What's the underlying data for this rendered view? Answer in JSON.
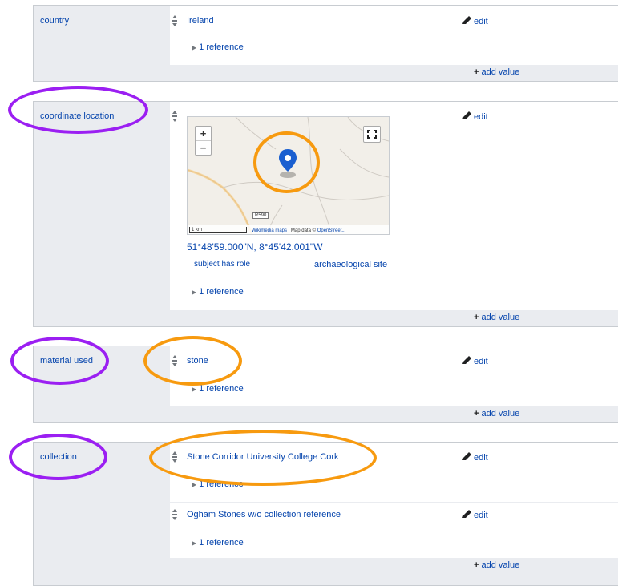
{
  "statements": {
    "country": {
      "property": "country",
      "value": "Ireland",
      "reference": "1 reference",
      "edit": "edit",
      "add_value": "add value"
    },
    "coordinate_location": {
      "property": "coordinate location",
      "coordinates": "51°48'59.000\"N, 8°45'42.001\"W",
      "qualifier_property": "subject has role",
      "qualifier_value": "archaeological site",
      "reference": "1 reference",
      "edit": "edit",
      "add_value": "add value",
      "map": {
        "zoom_in": "+",
        "zoom_out": "−",
        "scale": "1 km",
        "attribution_link": "Wikimedia maps",
        "attribution_text": " | Map data © ",
        "attribution_osm": "OpenStreet...",
        "road_label": "R590"
      }
    },
    "material_used": {
      "property": "material used",
      "value": "stone",
      "reference": "1 reference",
      "edit": "edit",
      "add_value": "add value"
    },
    "collection": {
      "property": "collection",
      "values": [
        {
          "value": "Stone Corridor University College Cork",
          "reference": "1 reference",
          "edit": "edit"
        },
        {
          "value": "Ogham Stones w/o collection reference",
          "reference": "1 reference",
          "edit": "edit"
        }
      ],
      "add_value": "add value"
    }
  },
  "colors": {
    "link": "#0645ad",
    "panel": "#eaecf0",
    "annotation_purple": "#9b1ff2",
    "annotation_orange": "#f79a0f",
    "marker": "#1a5fd0"
  },
  "icons": [
    "rank-icon",
    "pencil-icon",
    "expand-triangle-icon",
    "fullscreen-icon",
    "map-marker-icon"
  ]
}
